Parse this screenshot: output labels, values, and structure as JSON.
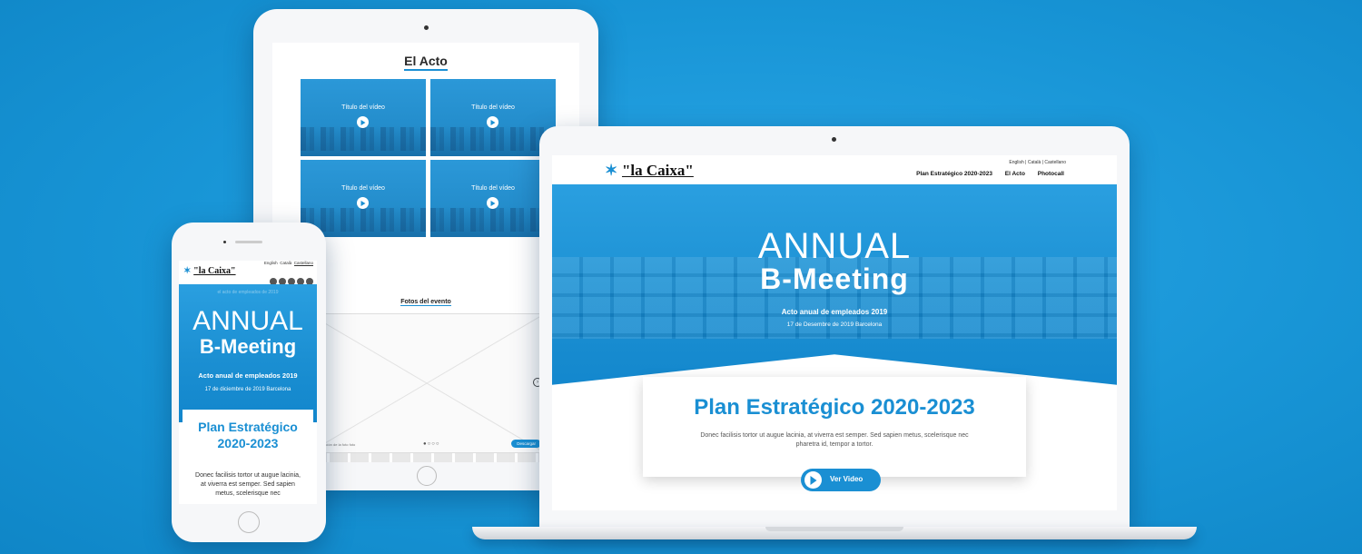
{
  "brand": {
    "logo_star": "✶",
    "logo_text": "\"la Caixa\""
  },
  "tablet": {
    "section_title": "El Acto",
    "videos": [
      {
        "title": "Título del vídeo"
      },
      {
        "title": "Título del vídeo"
      },
      {
        "title": "Título del vídeo"
      },
      {
        "title": "Título del vídeo"
      }
    ],
    "gallery_title": "Fotos del evento",
    "gallery_caption": "Descripción de la foto foto",
    "gallery_dots": "●○○○",
    "download_label": "Descargar",
    "prev_icon": "‹",
    "next_icon": "›"
  },
  "laptop": {
    "languages": "English | Català | Castellano",
    "menu": [
      "Plan Estratégico 2020-2023",
      "El Acto",
      "Photocall"
    ],
    "hero_line1": "ANNUAL",
    "hero_line2": "B-Meeting",
    "hero_subtitle": "Acto anual de empleados 2019",
    "hero_date": "17 de Desembre de 2019 Barcelona",
    "plan_title": "Plan Estratégico 2020-2023",
    "plan_text": "Donec facilisis tortor ut augue lacinia, at viverra est semper. Sed sapien metus, scelerisque nec pharetra id, tempor a tortor.",
    "video_button": "Ver Video"
  },
  "phone": {
    "languages": [
      "English",
      "Català",
      "Castellano"
    ],
    "socials": [
      "facebook-icon",
      "twitter-icon",
      "instagram-icon",
      "youtube-icon",
      "linkedin-icon"
    ],
    "hero_small": "el acto de empleados de 2019",
    "hero_line1": "ANNUAL",
    "hero_line2": "B-Meeting",
    "hero_subtitle": "Acto anual de empleados 2019",
    "hero_date": "17 de diciembre de 2019 Barcelona",
    "plan_title": "Plan Estratégico 2020-2023",
    "plan_text": "Donec facilisis tortor ut augue lacinia, at viverra est semper. Sed sapien metus, scelerisque nec"
  },
  "colors": {
    "background": "#1895d6",
    "accent": "#1a8fd3",
    "device": "#f6f7f9"
  }
}
